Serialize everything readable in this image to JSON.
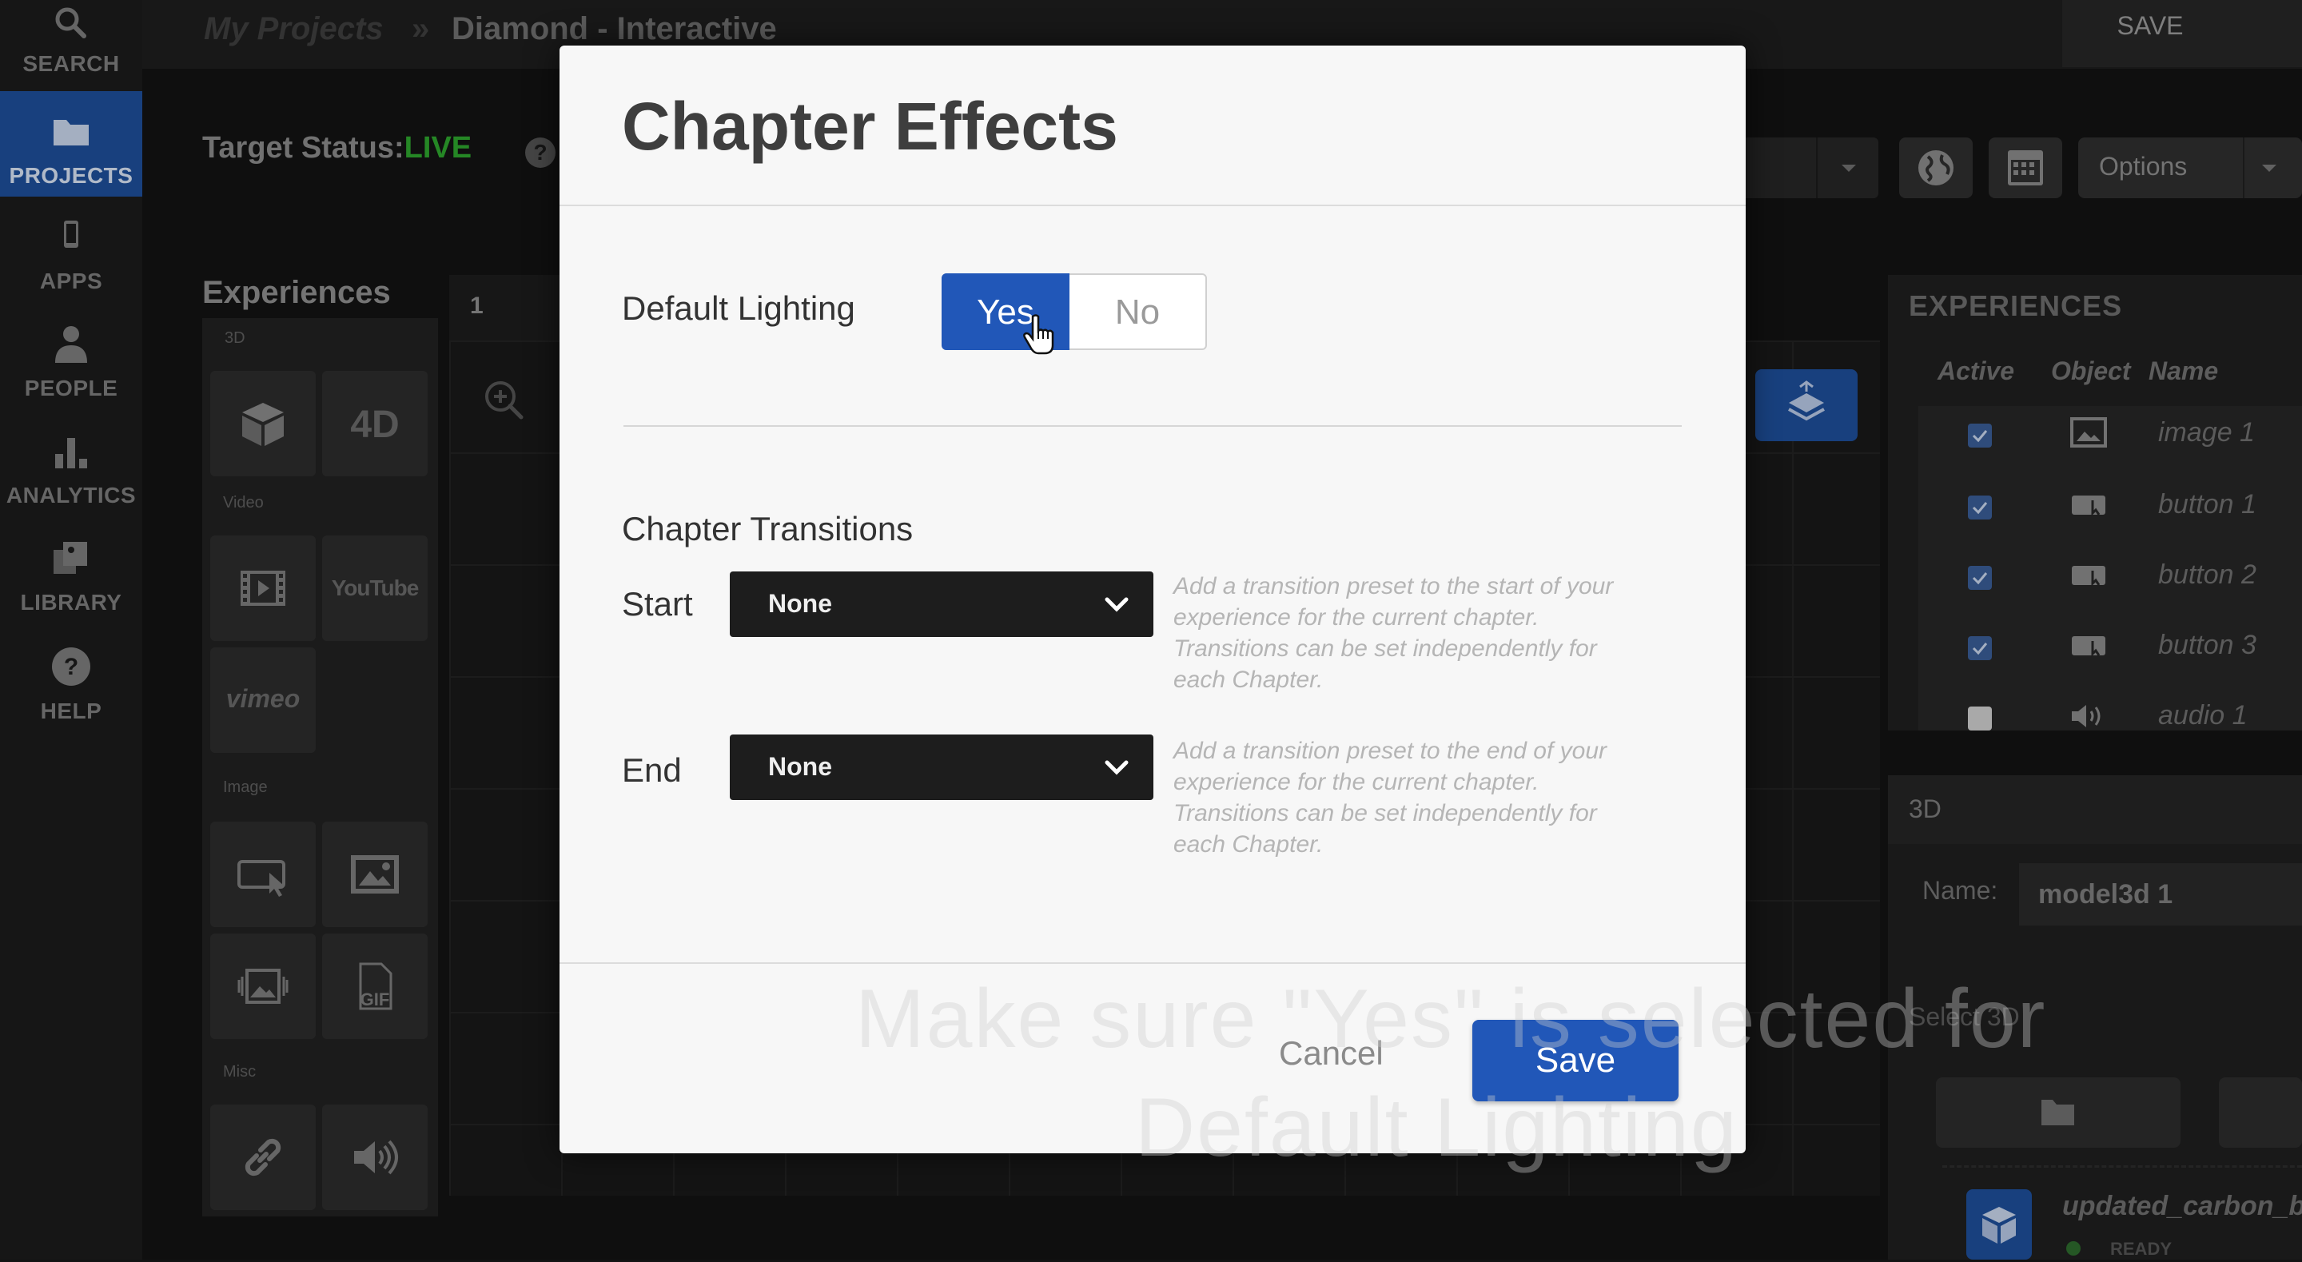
{
  "nav": {
    "items": [
      {
        "label": "SEARCH",
        "icon": "search-icon"
      },
      {
        "label": "PROJECTS",
        "icon": "folder-icon",
        "active": true
      },
      {
        "label": "APPS",
        "icon": "phone-icon"
      },
      {
        "label": "PEOPLE",
        "icon": "person-icon"
      },
      {
        "label": "ANALYTICS",
        "icon": "bar-chart-icon"
      },
      {
        "label": "LIBRARY",
        "icon": "library-icon"
      },
      {
        "label": "HELP",
        "icon": "help-icon"
      }
    ]
  },
  "header": {
    "breadcrumb_root": "My Projects",
    "breadcrumb_separator": "»",
    "breadcrumb_current": "Diamond - Interactive",
    "save_label": "SAVE"
  },
  "toolbar": {
    "target_status_label": "Target Status:",
    "target_status_value": "LIVE",
    "help_glyph": "?",
    "options_label": "Options"
  },
  "palette": {
    "title": "Experiences",
    "sections": {
      "three_d": "3D",
      "video": "Video",
      "image": "Image",
      "misc": "Misc"
    },
    "four_d_label": "4D",
    "youtube_label": "YouTube",
    "vimeo_label": "vimeo",
    "gif_label": "GIF"
  },
  "canvas": {
    "tab_label": "1"
  },
  "experiences_panel": {
    "title": "EXPERIENCES",
    "columns": [
      "Active",
      "Object",
      "Name"
    ],
    "rows": [
      {
        "name": "image 1",
        "active": true,
        "object": "image-icon"
      },
      {
        "name": "button 1",
        "active": true,
        "object": "button-icon"
      },
      {
        "name": "button 2",
        "active": true,
        "object": "button-icon"
      },
      {
        "name": "button 3",
        "active": true,
        "object": "button-icon"
      },
      {
        "name": "audio 1",
        "active": false,
        "object": "speaker-icon"
      }
    ]
  },
  "panel_3d": {
    "title": "3D",
    "name_label": "Name:",
    "name_value": "model3d 1",
    "select_label": "Select 3D",
    "asset_name": "updated_carbon_b",
    "asset_status": "READY"
  },
  "modal": {
    "title": "Chapter Effects",
    "default_lighting_label": "Default Lighting",
    "yes_label": "Yes",
    "no_label": "No",
    "default_lighting_selected": "Yes",
    "chapter_transitions_label": "Chapter Transitions",
    "start_label": "Start",
    "start_value": "None",
    "start_hint": "Add a transition preset to the start of your experience for the current chapter. Transitions can be set independently for each Chapter.",
    "end_label": "End",
    "end_value": "None",
    "end_hint": "Add a transition preset to the end of your experience for the current chapter. Transitions can be set independently for each Chapter.",
    "cancel_label": "Cancel",
    "save_label": "Save"
  },
  "caption": {
    "line1": "Make sure \"Yes\" is selected for",
    "line2": "Default Lighting"
  },
  "colors": {
    "accent": "#2157b8",
    "live": "#2ea52e",
    "background": "#131313",
    "modal_bg": "#f7f7f7"
  }
}
